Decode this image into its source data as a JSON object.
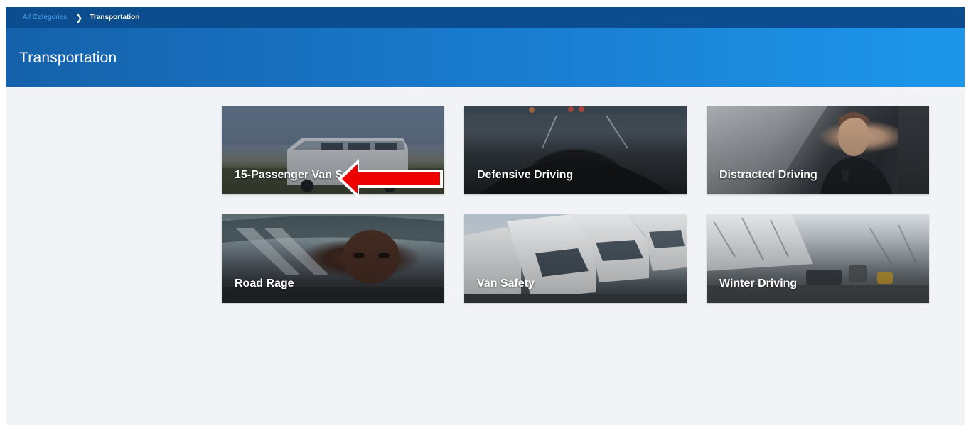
{
  "breadcrumb": {
    "root_label": "All Categories",
    "current_label": "Transportation"
  },
  "header": {
    "title": "Transportation"
  },
  "cards": [
    {
      "title": "15-Passenger Van Safety"
    },
    {
      "title": "Defensive Driving"
    },
    {
      "title": "Distracted Driving"
    },
    {
      "title": "Road Rage"
    },
    {
      "title": "Van Safety"
    },
    {
      "title": "Winter Driving"
    }
  ],
  "annotation": {
    "arrow_color": "#ee0000",
    "points_to": "Defensive Driving"
  }
}
